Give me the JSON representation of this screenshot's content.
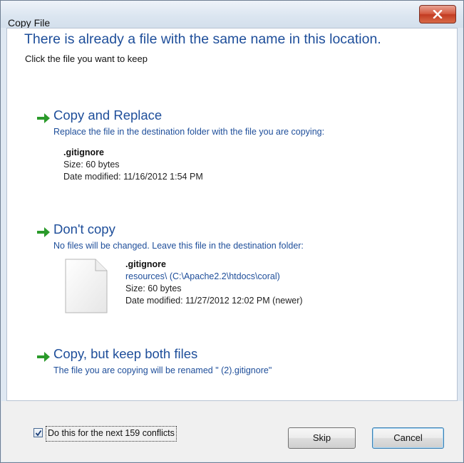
{
  "window": {
    "title": "Copy File"
  },
  "header": {
    "heading": "There is already a file with the same name in this location.",
    "subheading": "Click the file you want to keep"
  },
  "options": {
    "replace": {
      "title": "Copy and Replace",
      "description": "Replace the file in the destination folder with the file you are copying:",
      "file": {
        "name": ".gitignore",
        "size": "Size: 60 bytes",
        "modified": "Date modified: 11/16/2012 1:54 PM"
      }
    },
    "dont_copy": {
      "title": "Don't copy",
      "description": "No files will be changed. Leave this file in the destination folder:",
      "file": {
        "name": ".gitignore",
        "path": "resources\\ (C:\\Apache2.2\\htdocs\\coral)",
        "size": "Size: 60 bytes",
        "modified": "Date modified: 11/27/2012 12:02 PM (newer)"
      }
    },
    "keep_both": {
      "title": "Copy, but keep both files",
      "description": "The file you are copying will be renamed \" (2).gitignore\""
    }
  },
  "footer": {
    "checkbox_label": "Do this for the next 159 conflicts",
    "checkbox_checked": true,
    "skip_label": "Skip",
    "cancel_label": "Cancel"
  },
  "colors": {
    "link_blue": "#1e4e9a",
    "arrow_green": "#2a9a2a",
    "close_red": "#c23b22"
  }
}
